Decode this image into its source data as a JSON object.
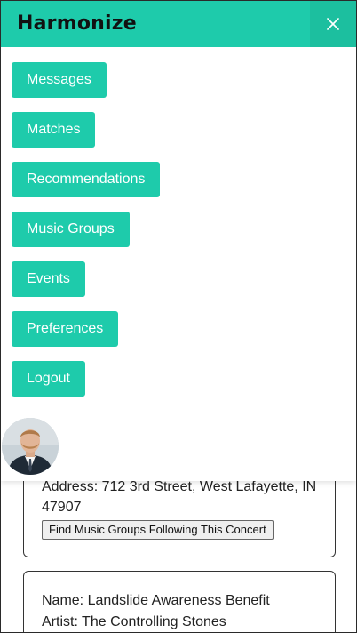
{
  "app": {
    "logo_text": "Harmonize",
    "brand_color": "#1ecbab",
    "close_icon": "close-icon"
  },
  "nav": {
    "items": [
      {
        "label": "Messages"
      },
      {
        "label": "Matches"
      },
      {
        "label": "Recommendations"
      },
      {
        "label": "Music Groups"
      },
      {
        "label": "Events"
      },
      {
        "label": "Preferences"
      },
      {
        "label": "Logout"
      }
    ]
  },
  "profile": {
    "avatar_icon": "user-avatar"
  },
  "events": [
    {
      "address_line": "Address: 712 3rd Street, West Lafayette, IN 47907",
      "find_button": "Find Music Groups Following This Concert"
    },
    {
      "name_line": "Name: Landslide Awareness Benefit",
      "artist_line": "Artist: The Controlling Stones"
    }
  ]
}
